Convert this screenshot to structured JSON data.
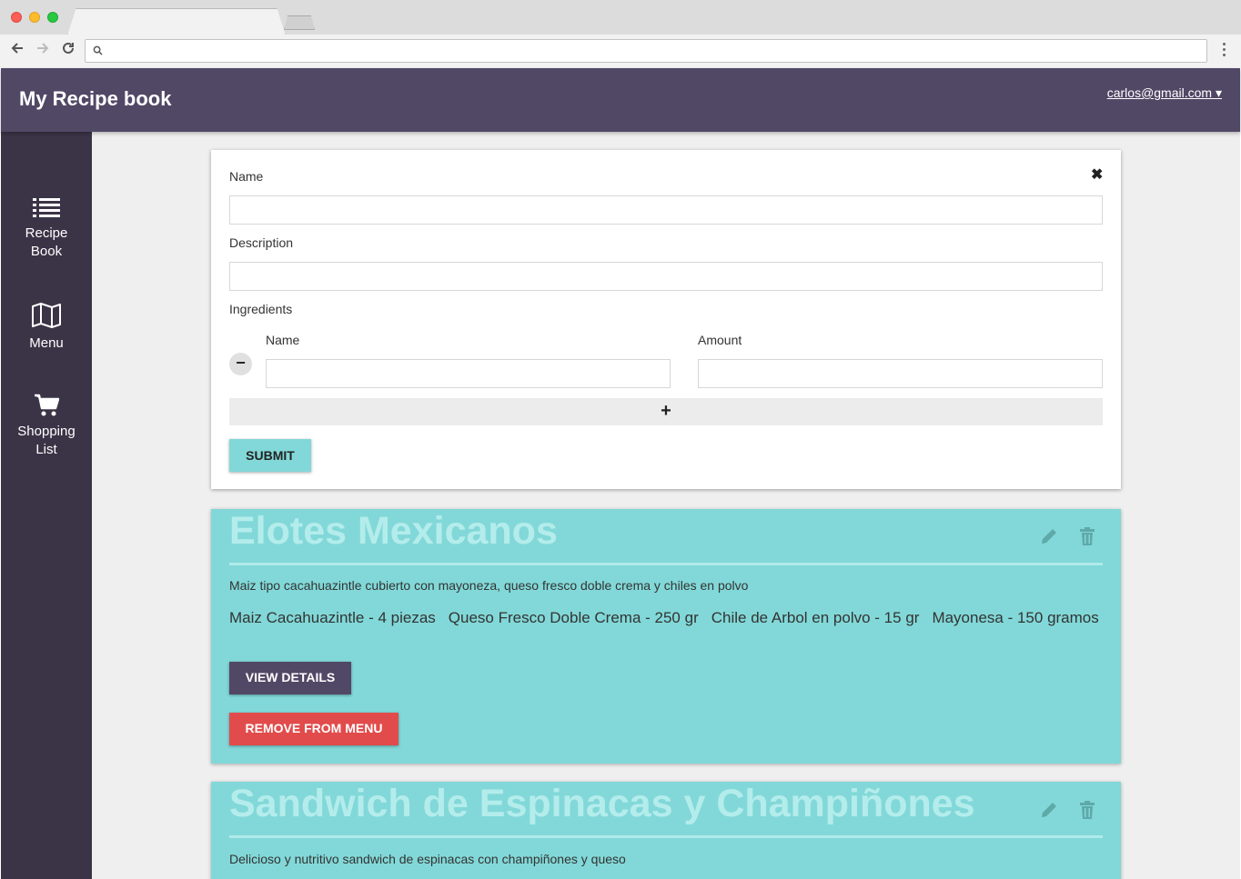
{
  "browser": {
    "tab_title": "",
    "url": ""
  },
  "header": {
    "title": "My Recipe book",
    "user": "carlos@gmail.com ▾"
  },
  "sidebar": {
    "items": [
      {
        "label": "Recipe Book",
        "icon": "list-icon"
      },
      {
        "label": "Menu",
        "icon": "map-icon"
      },
      {
        "label": "Shopping List",
        "icon": "cart-icon"
      }
    ]
  },
  "form": {
    "name_label": "Name",
    "name_value": "",
    "description_label": "Description",
    "description_value": "",
    "ingredients_label": "Ingredients",
    "ingredient_name_label": "Name",
    "ingredient_amount_label": "Amount",
    "ingredient_name_value": "",
    "ingredient_amount_value": "",
    "close_symbol": "✖",
    "remove_symbol": "−",
    "add_symbol": "+",
    "submit_label": "SUBMIT"
  },
  "recipes": [
    {
      "title": "Elotes Mexicanos",
      "description": "Maiz tipo cacahuazintle cubierto con mayoneza, queso fresco doble crema y chiles en polvo",
      "ingredients": [
        "Maiz Cacahuazintle - 4 piezas",
        "Queso Fresco Doble Crema - 250 gr",
        "Chile de Arbol en polvo - 15 gr",
        "Mayonesa - 150 gramos"
      ],
      "details_label": "VIEW DETAILS",
      "remove_label": "REMOVE FROM MENU"
    },
    {
      "title": "Sandwich de Espinacas y Champiñones",
      "description": "Delicioso y nutritivo sandwich de espinacas con champiñones y queso"
    }
  ],
  "colors": {
    "header": "#514866",
    "sidebar": "#3b3447",
    "accent": "#82d8d8",
    "danger": "#e24b4b"
  }
}
